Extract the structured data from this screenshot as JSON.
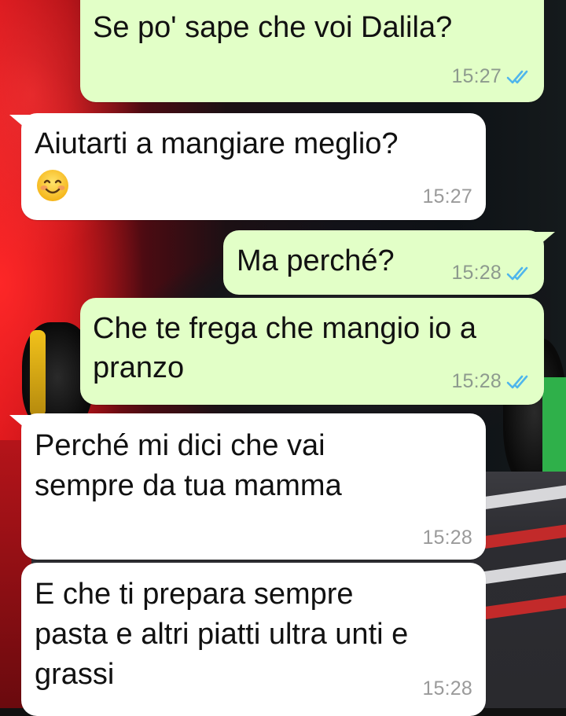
{
  "colors": {
    "outgoing_bubble": "#e2ffc7",
    "incoming_bubble": "#ffffff",
    "read_ticks": "#4fb6ec",
    "timestamp": "#8d9a8e"
  },
  "messages": [
    {
      "direction": "outgoing",
      "lines": [
        "Se po' sape che voi Dalila?"
      ],
      "time": "15:27",
      "status_icon": "double-check-read-icon"
    },
    {
      "direction": "incoming",
      "lines": [
        "Aiutarti a mangiare meglio?"
      ],
      "emoji": "smiling-face-icon",
      "time": "15:27"
    },
    {
      "direction": "outgoing",
      "lines": [
        "Ma perché?"
      ],
      "time": "15:28",
      "status_icon": "double-check-read-icon"
    },
    {
      "direction": "outgoing",
      "lines": [
        "Che te frega che mangio io a",
        "pranzo"
      ],
      "time": "15:28",
      "status_icon": "double-check-read-icon"
    },
    {
      "direction": "incoming",
      "lines": [
        "Perché mi dici che vai",
        "sempre da tua mamma"
      ],
      "time": "15:28"
    },
    {
      "direction": "incoming",
      "lines": [
        "E che ti prepara sempre",
        "pasta e altri piatti ultra unti e",
        "grassi"
      ],
      "time": "15:28"
    }
  ]
}
